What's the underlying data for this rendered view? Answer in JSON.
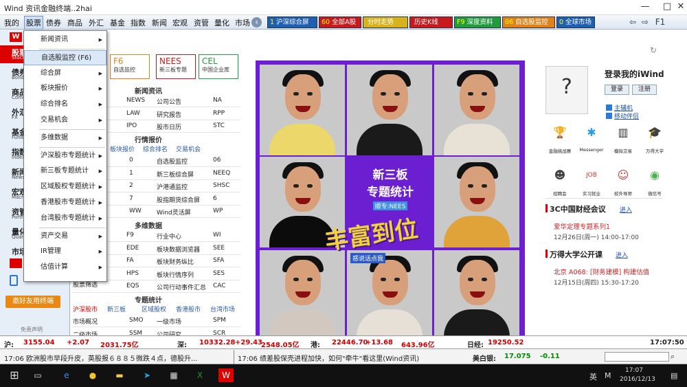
{
  "window": {
    "title": "Wind 资讯金融终端..2hai"
  },
  "menu": [
    "我的",
    "股票",
    "债券",
    "商品",
    "外汇",
    "基金",
    "指数",
    "新闻",
    "宏观",
    "资管",
    "量化",
    "市场"
  ],
  "quick_buttons": [
    {
      "num": "1",
      "label": "沪深综合屏",
      "color": "#1f5fb2"
    },
    {
      "num": "60",
      "label": "全部A股",
      "color": "#c8191c"
    },
    {
      "num": "",
      "label": "分时走势",
      "color": "#d8b21c"
    },
    {
      "num": "",
      "label": "历史K线",
      "color": "#c8191c"
    },
    {
      "num": "F9",
      "label": "深度资料",
      "color": "#219b3e"
    },
    {
      "num": "06",
      "label": "自选股监控",
      "color": "#e0821b"
    },
    {
      "num": "0",
      "label": "全球市场",
      "color": "#1f5fb2"
    }
  ],
  "left_nav": [
    {
      "cn": "股票",
      "en": "Stock",
      "sel": true
    },
    {
      "cn": "债券",
      "en": "Bond"
    },
    {
      "cn": "商品",
      "en": "Commodity"
    },
    {
      "cn": "外汇",
      "en": "FX"
    },
    {
      "cn": "基金",
      "en": "Fund"
    },
    {
      "cn": "指数",
      "en": "Index"
    },
    {
      "cn": "新闻",
      "en": "News"
    },
    {
      "cn": "宏观",
      "en": "Macro"
    },
    {
      "cn": "资管",
      "en": "Portfolio"
    },
    {
      "cn": "量化",
      "en": "Quant"
    },
    {
      "cn": "市场",
      "en": ""
    }
  ],
  "invite_label": "邀好友用终端",
  "disclaimer": "免责声明",
  "dropdown": [
    {
      "label": "新闻资讯",
      "arrow": true
    },
    {
      "label": "自选股监控 (F6)",
      "sel": true
    },
    {
      "label": "综合屏",
      "arrow": true
    },
    {
      "label": "板块报价",
      "arrow": true
    },
    {
      "label": "综合排名",
      "arrow": true
    },
    {
      "label": "交易机会",
      "arrow": true
    },
    {
      "label": "多维数据",
      "arrow": true
    },
    {
      "label": "沪深股市专题统计",
      "arrow": true
    },
    {
      "label": "新三板专题统计",
      "arrow": true
    },
    {
      "label": "区域股权专题统计",
      "arrow": true
    },
    {
      "label": "香港股市专题统计",
      "arrow": true
    },
    {
      "label": "台湾股市专题统计",
      "arrow": true
    },
    {
      "label": "资产交易",
      "arrow": true
    },
    {
      "label": "IR管理",
      "arrow": true
    },
    {
      "label": "估值计算",
      "arrow": true
    }
  ],
  "color_buttons": [
    {
      "big": "F6",
      "label": "自选监控",
      "color": "#e0821b"
    },
    {
      "big": "NEES",
      "label": "新三板专题",
      "color": "#c8191c"
    },
    {
      "big": "CEL",
      "label": "中国企业库",
      "color": "#219b3e"
    }
  ],
  "sections": {
    "news": {
      "title": "新闻资讯",
      "rows": [
        [
          "NEWS",
          "公司公告",
          "NA"
        ],
        [
          "LAW",
          "研究报告",
          "RPP"
        ],
        [
          "IPO",
          "股市日历",
          "STC"
        ]
      ]
    },
    "quotes": {
      "title": "行情报价",
      "tabs": [
        "板块报价",
        "综合排名",
        "交易机会"
      ],
      "rows": [
        [
          "筑",
          "0",
          "自选股监控",
          "06"
        ],
        [
          "合屏",
          "1",
          "新三板综合屏",
          "NEEQ"
        ],
        [
          "合屏",
          "2",
          "沪港通监控",
          "SHSC"
        ],
        [
          "合屏",
          "7",
          "股指期货综合屏",
          "6"
        ],
        [
          "合屏",
          "WW",
          "Wind灵活屏",
          "WP"
        ]
      ]
    },
    "multi": {
      "title": "多维数据",
      "rows": [
        [
          "F9",
          "行业中心",
          "WI"
        ],
        [
          "EDE",
          "板块数据浏览器",
          "SEE"
        ],
        [
          "FA",
          "板块财务纵比",
          "SFA"
        ],
        [
          "HPS",
          "板块行情序列",
          "SES"
        ],
        [
          "EQS",
          "公司行动事件汇总",
          "CAC"
        ]
      ],
      "first": "股票筛选"
    },
    "stats": {
      "title": "专题统计",
      "tabs": [
        "沪深股市",
        "新三板",
        "区域股权",
        "香港股市",
        "台湾市场"
      ],
      "rows": [
        [
          "市场概况",
          "SMO",
          "一级市场",
          "SPM"
        ],
        [
          "二级市场",
          "SSM",
          "公司研究",
          "SCR"
        ]
      ]
    }
  },
  "banner": {
    "title1": "新三板",
    "title2": "专题统计",
    "tag": "顺专:NEES",
    "slogan": "丰富到位",
    "sub": "惑说话点我"
  },
  "right_panel": {
    "login_title": "登录我的iWind",
    "login_btn": "登录",
    "register_btn": "注册",
    "links": [
      "主辅机",
      "移动伴侣"
    ],
    "apps": [
      [
        "金融挑战赛",
        "Messenger",
        "模拟交易",
        "万得大学"
      ],
      [
        "招聘会",
        "实习就业",
        "校外导师",
        "微信号"
      ]
    ],
    "events": [
      {
        "title": "3C中国财经会议",
        "link": "进入",
        "items": [
          [
            "爱华定理专题系列1",
            "12月26日(周一) 14:00-17:00"
          ]
        ]
      },
      {
        "title": "万得大学公开课",
        "link": "进入",
        "items": [
          [
            "北京  A068: [财务建模] 构建估值",
            "12月15日(周四) 15:30-17:20"
          ]
        ]
      }
    ]
  },
  "ticker": [
    {
      "name": "沪:",
      "value": "3155.04",
      "chg": "+2.07",
      "amt": "2031.75亿"
    },
    {
      "name": "深:",
      "value": "10332.28",
      "chg": "+29.43",
      "amt": "2548.05亿"
    },
    {
      "name": "港:",
      "value": "22446.70",
      "chg": "+13.68",
      "amt": "643.96亿"
    },
    {
      "name": "日经:",
      "value": "19250.52",
      "chg": "",
      "amt": ""
    }
  ],
  "ticker_time": "17:07:50",
  "news_ticker": [
    "17:06 欧洲股市早段升皮，英股报６８８５微跌４点，德股升...",
    "17:06 绩差股保壳进程加快，如何\"牵牛\"看这里(Wind资讯)"
  ],
  "fx": {
    "name": "美白银:",
    "value": "17.075",
    "chg": "-0.11"
  },
  "taskbar": {
    "time": "17:07",
    "date": "2016/12/13",
    "lang": "英"
  },
  "colors": {
    "accent": "#d00000",
    "panel": "#e6eef8"
  }
}
